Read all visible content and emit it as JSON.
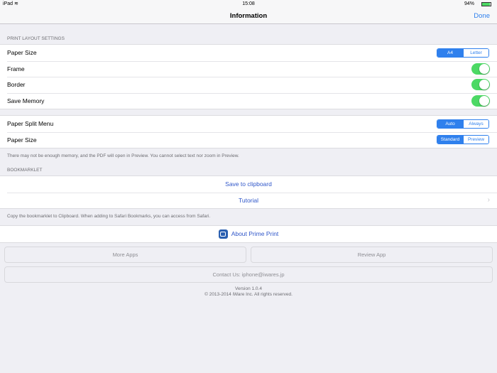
{
  "status": {
    "device": "iPad",
    "time": "15:08",
    "battery": "94%"
  },
  "nav": {
    "title": "Information",
    "done": "Done"
  },
  "s1": {
    "header": "PRINT LAYOUT SETTINGS",
    "paper_size": "Paper Size",
    "paper_opts": [
      "A4",
      "Letter"
    ],
    "frame": "Frame",
    "border": "Border",
    "save_memory": "Save Memory",
    "toggles": {
      "frame": true,
      "border": true,
      "save_memory": true
    }
  },
  "s2": {
    "split": "Paper Split Menu",
    "split_opts": [
      "Auto",
      "Always"
    ],
    "paper_size": "Paper Size",
    "paper_opts": [
      "Standard",
      "Preview"
    ],
    "footer": "There may not be enough memory, and the PDF will open in Preview. You cannot select text nor zoom in Preview."
  },
  "s3": {
    "header": "BOOKMARKLET",
    "save": "Save to clipboard",
    "tutorial": "Tutorial",
    "footer": "Copy the bookmarklet to Clipboard. When adding to Safari Bookmarks, you can access from Safari."
  },
  "about": "About Prime Print",
  "buttons": {
    "more": "More Apps",
    "review": "Review App",
    "contact": "Contact Us: iphone@iwares.jp"
  },
  "version": "Version 1.0.4",
  "copyright": "© 2013-2014 iWare Inc. All rights reserved.",
  "colors": {
    "accent": "#2f80ed",
    "toggle": "#4cd964"
  }
}
